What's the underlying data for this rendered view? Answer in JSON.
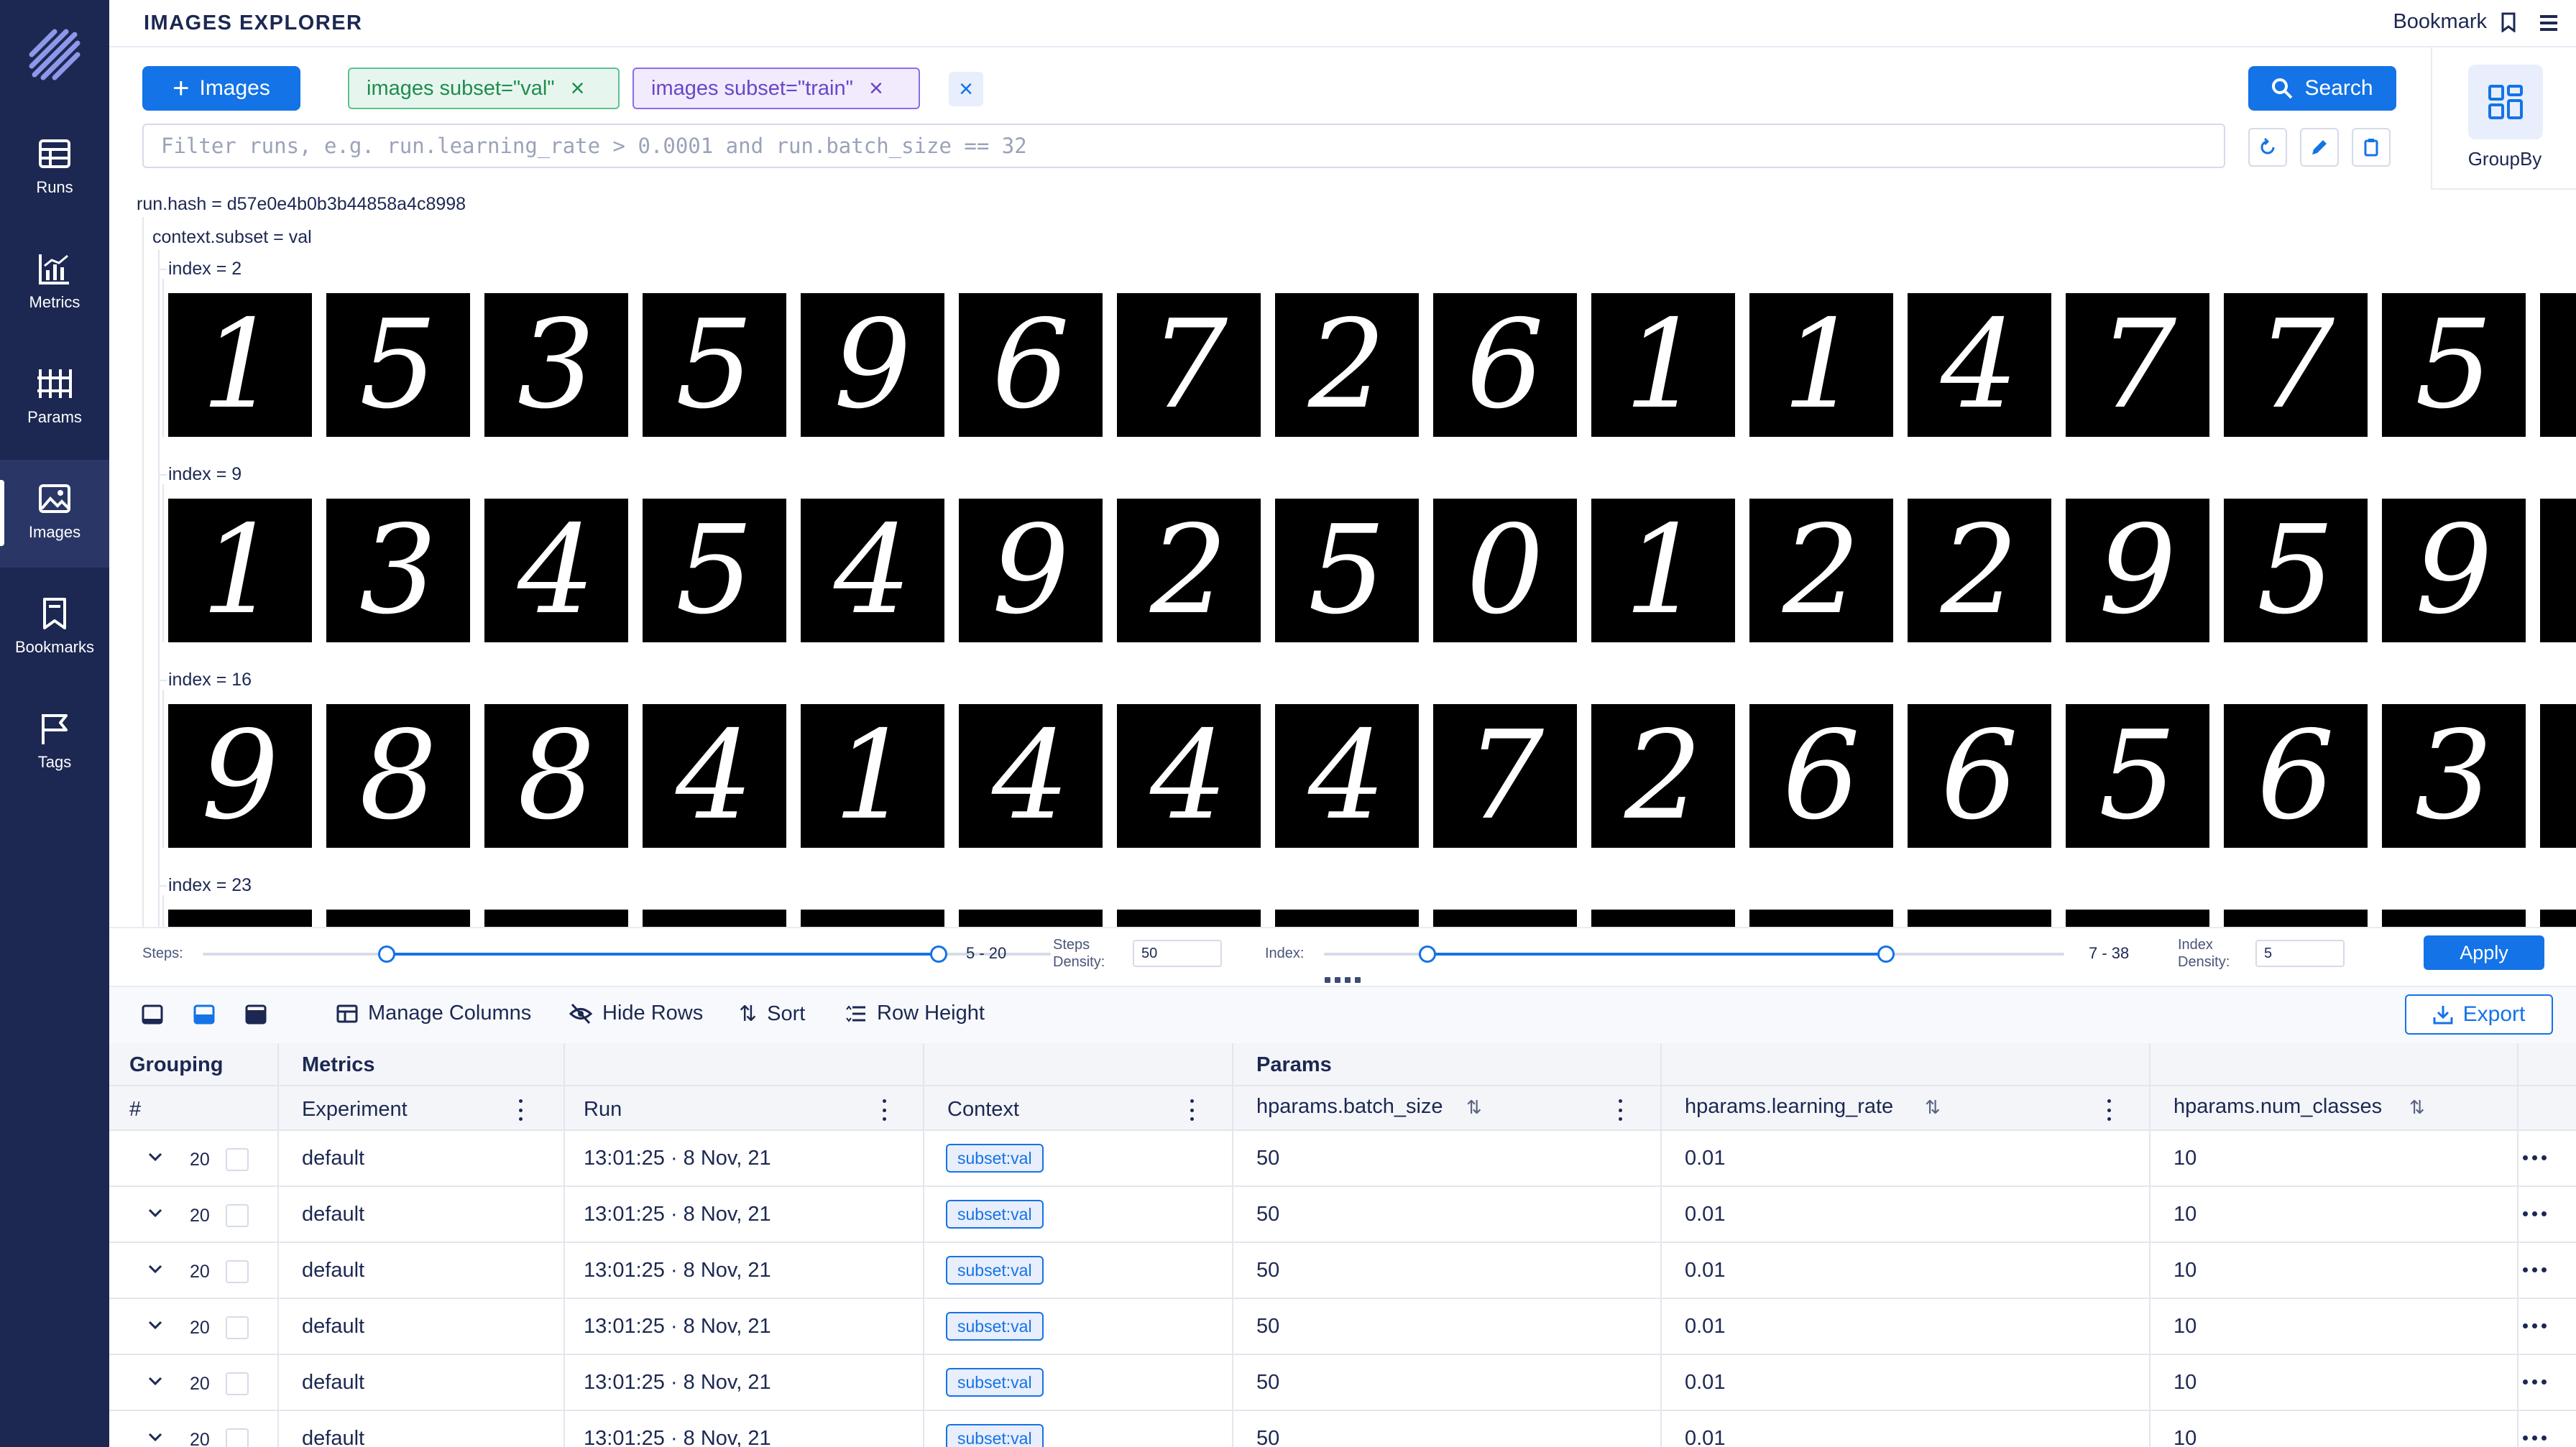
{
  "sidebar": {
    "items": [
      {
        "label": "Runs",
        "icon": "table-icon"
      },
      {
        "label": "Metrics",
        "icon": "chart-icon"
      },
      {
        "label": "Params",
        "icon": "params-icon"
      },
      {
        "label": "Images",
        "icon": "image-icon",
        "active": true
      },
      {
        "label": "Bookmarks",
        "icon": "bookmark-icon"
      },
      {
        "label": "Tags",
        "icon": "flag-icon"
      }
    ]
  },
  "header": {
    "title": "IMAGES EXPLORER",
    "bookmark_label": "Bookmark"
  },
  "search": {
    "images_button": "Images",
    "chips": [
      "images subset=\"val\"",
      "images subset=\"train\""
    ],
    "search_button": "Search",
    "filter_placeholder": "Filter runs, e.g. run.learning_rate > 0.0001 and run.batch_size == 32",
    "groupby_label": "GroupBy"
  },
  "groups": {
    "run_hash": "run.hash = d57e0e4b0b3b44858a4c8998",
    "context": "context.subset = val",
    "rows": [
      {
        "label": "index = 2",
        "digits": [
          "1",
          "5",
          "3",
          "5",
          "9",
          "6",
          "7",
          "2",
          "6",
          "1",
          "1",
          "4",
          "7",
          "7",
          "5"
        ]
      },
      {
        "label": "index = 9",
        "digits": [
          "1",
          "3",
          "4",
          "5",
          "4",
          "9",
          "2",
          "5",
          "0",
          "1",
          "2",
          "2",
          "9",
          "5",
          "9"
        ]
      },
      {
        "label": "index = 16",
        "digits": [
          "9",
          "8",
          "8",
          "4",
          "1",
          "4",
          "4",
          "4",
          "7",
          "2",
          "6",
          "6",
          "5",
          "6",
          "3"
        ]
      },
      {
        "label": "index = 23",
        "digits": []
      }
    ]
  },
  "controls": {
    "steps_label": "Steps:",
    "steps_range": "5 - 20",
    "steps_density_label_1": "Steps",
    "steps_density_label_2": "Density:",
    "steps_density_value": "50",
    "index_label": "Index:",
    "index_range": "7 - 38",
    "index_density_label_1": "Index",
    "index_density_label_2": "Density:",
    "index_density_value": "5",
    "apply_button": "Apply"
  },
  "toolbar": {
    "manage_columns": "Manage Columns",
    "hide_rows": "Hide Rows",
    "sort": "Sort",
    "row_height": "Row Height",
    "export": "Export"
  },
  "table": {
    "groups": {
      "grouping": "Grouping",
      "metrics": "Metrics",
      "params": "Params"
    },
    "columns": {
      "index": "#",
      "experiment": "Experiment",
      "run": "Run",
      "context": "Context",
      "batch_size": "hparams.batch_size",
      "learning_rate": "hparams.learning_rate",
      "num_classes": "hparams.num_classes"
    },
    "rows": [
      {
        "count": "20",
        "experiment": "default",
        "run": "13:01:25 · 8 Nov, 21",
        "context": "subset:val",
        "batch_size": "50",
        "learning_rate": "0.01",
        "num_classes": "10"
      },
      {
        "count": "20",
        "experiment": "default",
        "run": "13:01:25 · 8 Nov, 21",
        "context": "subset:val",
        "batch_size": "50",
        "learning_rate": "0.01",
        "num_classes": "10"
      },
      {
        "count": "20",
        "experiment": "default",
        "run": "13:01:25 · 8 Nov, 21",
        "context": "subset:val",
        "batch_size": "50",
        "learning_rate": "0.01",
        "num_classes": "10"
      },
      {
        "count": "20",
        "experiment": "default",
        "run": "13:01:25 · 8 Nov, 21",
        "context": "subset:val",
        "batch_size": "50",
        "learning_rate": "0.01",
        "num_classes": "10"
      },
      {
        "count": "20",
        "experiment": "default",
        "run": "13:01:25 · 8 Nov, 21",
        "context": "subset:val",
        "batch_size": "50",
        "learning_rate": "0.01",
        "num_classes": "10"
      },
      {
        "count": "20",
        "experiment": "default",
        "run": "13:01:25 · 8 Nov, 21",
        "context": "subset:val",
        "batch_size": "50",
        "learning_rate": "0.01",
        "num_classes": "10"
      }
    ]
  },
  "colors": {
    "sidebar_bg": "#1c2852",
    "primary": "#1473e6",
    "chip_green": "#5cc38c",
    "chip_purple": "#8e6be6"
  }
}
